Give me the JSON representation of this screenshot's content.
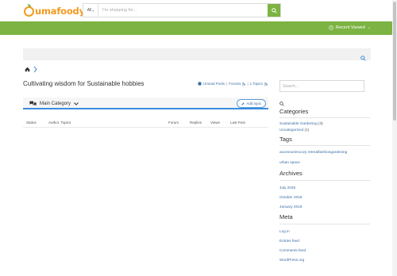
{
  "brand": {
    "name_main": "uma",
    "name_accent": "foody",
    "name_dot": "."
  },
  "header": {
    "category_select": "All",
    "search_placeholder": "I'm shopping for..."
  },
  "navbar": {
    "recent_viewed_label": "Recent Viewed"
  },
  "page": {
    "title": "Cultivating wisdom for Sustainable hobbies",
    "sublinks": [
      "Umead Posts",
      "Forums",
      "1 Topics"
    ]
  },
  "category_bar": {
    "label": "Main Category",
    "add_topic_label": "Add topic"
  },
  "table": {
    "columns": [
      "Status",
      "Author, Topics",
      "Forum",
      "Replies",
      "Views",
      "Last Post"
    ]
  },
  "sidebar": {
    "search_placeholder": "Search...",
    "categories_title": "Categories",
    "categories": [
      {
        "label": "Sustainable Gardening",
        "count": "(3)"
      },
      {
        "label": "Uncategorized",
        "count": "(1)"
      }
    ],
    "tags_title": "Tags",
    "tags": [
      "accessoriescozy retreatfashiongardening",
      "urban space"
    ],
    "archives_title": "Archives",
    "archives": [
      "July 2025",
      "October 2018",
      "January 2019"
    ],
    "meta_title": "Meta",
    "meta": [
      "Log in",
      "Entries feed",
      "Comments feed",
      "WordPress.org"
    ]
  },
  "colors": {
    "brand_orange": "#f29a1f",
    "brand_green": "#7cb342",
    "link_blue": "#3a6ea5",
    "accent_blue": "#3a8dde"
  }
}
